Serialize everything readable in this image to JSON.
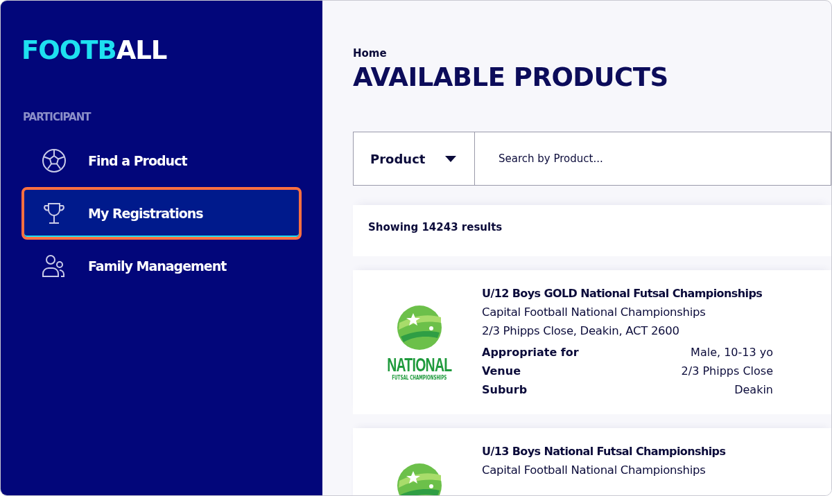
{
  "sidebar": {
    "logo": {
      "accent_text": "FOOTB",
      "text": "ALL"
    },
    "section_label": "PARTICIPANT",
    "items": [
      {
        "label": "Find a Product",
        "selected": false
      },
      {
        "label": "My Registrations",
        "selected": true
      },
      {
        "label": "Family Management",
        "selected": false
      }
    ]
  },
  "breadcrumb": "Home",
  "title": "AVAILABLE PRODUCTS",
  "search": {
    "filter": "Product",
    "placeholder": "Search by Product..."
  },
  "results_count": "Showing 14243 results",
  "products": [
    {
      "title": "U/12 Boys GOLD National Futsal Championships",
      "organiser": "Capital Football National Championships",
      "address": "2/3 Phipps Close, Deakin, ACT 2600",
      "logo": {
        "title": "NATIONAL",
        "subtitle": "FUTSAL CHAMPIONSHIPS"
      },
      "details": [
        {
          "label": "Appropriate for",
          "value": "Male, 10-13 yo"
        },
        {
          "label": "Venue",
          "value": "2/3 Phipps Close"
        },
        {
          "label": "Suburb",
          "value": "Deakin"
        }
      ]
    },
    {
      "title": "U/13 Boys National Futsal Championships",
      "organiser": "Capital Football National Championships"
    }
  ]
}
